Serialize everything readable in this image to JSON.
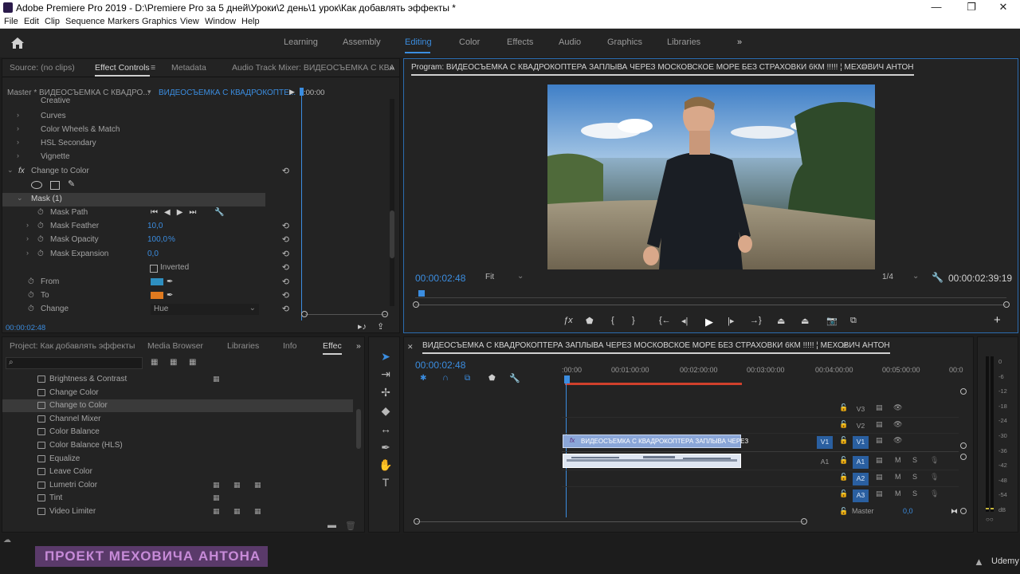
{
  "window": {
    "title": "Adobe Premiere Pro 2019 - D:\\Premiere Pro  за 5 дней\\Уроки\\2 день\\1 урок\\Как добавлять эффекты *",
    "minimize": "—",
    "maximize": "❐",
    "close": "✕"
  },
  "menu": [
    "File",
    "Edit",
    "Clip",
    "Sequence",
    "Markers",
    "Graphics",
    "View",
    "Window",
    "Help"
  ],
  "workspaces": [
    "Learning",
    "Assembly",
    "Editing",
    "Color",
    "Effects",
    "Audio",
    "Graphics",
    "Libraries"
  ],
  "workspace_more": "»",
  "effect_controls": {
    "tabs": [
      "Source: (no clips)",
      "Effect Controls",
      "Metadata",
      "Audio Track Mixer: ВИДЕОСЪЕМКА С КВА"
    ],
    "menu_icon": "≡",
    "more": "»",
    "master_label": "Master * ВИДЕОСЪЕМКА С КВАДРО...",
    "clip_label": "ВИДЕОСЪЕМКА С КВАДРОКОПТЕ...",
    "play_glyph": "▶",
    "timecode_start": ":00:00",
    "lumetri_items": [
      "Creative",
      "Curves",
      "Color Wheels & Match",
      "HSL Secondary",
      "Vignette"
    ],
    "effect_name": "Change to Color",
    "fx_label": "fx",
    "mask_name": "Mask (1)",
    "mask_path_label": "Mask Path",
    "mask_feather_label": "Mask Feather",
    "mask_feather_value": "10,0",
    "mask_opacity_label": "Mask Opacity",
    "mask_opacity_value": "100,0",
    "mask_opacity_unit": "%",
    "mask_expansion_label": "Mask Expansion",
    "mask_expansion_value": "0,0",
    "inverted_label": "Inverted",
    "from_label": "From",
    "from_color": "#2e8fc0",
    "to_label": "To",
    "to_color": "#e07a1f",
    "change_label": "Change",
    "change_value": "Hue",
    "timecode": "00:00:02:48"
  },
  "program": {
    "title": "Program: ВИДЕОСЪЕМКА С КВАДРОКОПТЕРА ЗАПЛЫВА ЧЕРЕЗ МОСКОВСКОЕ МОРЕ БЕЗ СТРАХОВКИ 6КМ !!!!! ¦ МЕХОВИЧ АНТОН",
    "menu_icon": "≡",
    "timecode": "00:00:02:48",
    "fit": "Fit",
    "resolution": "1/4",
    "duration": "00:00:02:39:19",
    "add": "+"
  },
  "project": {
    "tabs": [
      "Project: Как добавлять эффекты",
      "Media Browser",
      "Libraries",
      "Info",
      "Effec"
    ],
    "more": "»",
    "effects": [
      {
        "name": "Brightness & Contrast",
        "badges": 1
      },
      {
        "name": "Change Color",
        "badges": 0
      },
      {
        "name": "Change to Color",
        "badges": 0,
        "selected": true
      },
      {
        "name": "Channel Mixer",
        "badges": 0
      },
      {
        "name": "Color Balance",
        "badges": 0
      },
      {
        "name": "Color Balance (HLS)",
        "badges": 0
      },
      {
        "name": "Equalize",
        "badges": 0
      },
      {
        "name": "Leave Color",
        "badges": 0
      },
      {
        "name": "Lumetri Color",
        "badges": 3
      },
      {
        "name": "Tint",
        "badges": 1
      },
      {
        "name": "Video Limiter",
        "badges": 3
      }
    ]
  },
  "timeline": {
    "title": "ВИДЕОСЪЕМКА С КВАДРОКОПТЕРА ЗАПЛЫВА ЧЕРЕЗ МОСКОВСКОЕ МОРЕ БЕЗ СТРАХОВКИ 6КМ !!!!! ¦ МЕХОВИЧ АНТОН",
    "menu_icon": "≡",
    "timecode": "00:00:02:48",
    "ruler": [
      ":00:00",
      "00:01:00:00",
      "00:02:00:00",
      "00:03:00:00",
      "00:04:00:00",
      "00:05:00:00",
      "00:0"
    ],
    "video_tracks": [
      "V3",
      "V2",
      "V1"
    ],
    "audio_tracks": [
      "A1",
      "A2",
      "A3"
    ],
    "source_v": "V1",
    "source_a": "A1",
    "master_label": "Master",
    "master_value": "0,0",
    "clip_label": "ВИДЕОСЪЕМКА С КВАДРОКОПТЕРА ЗАПЛЫВА ЧЕРЕЗ",
    "clip_fx": "fx",
    "mute": "M",
    "solo": "S"
  },
  "meter": [
    "0",
    "-6",
    "-12",
    "-18",
    "-24",
    "-30",
    "-36",
    "-42",
    "-48",
    "-54",
    "dB"
  ],
  "footer": {
    "watermark": "ПРОЕКТ МЕХОВИЧА АНТОНА",
    "brand": "Udemy",
    "meter_toggle": "○○"
  },
  "colors": {
    "accent": "#3b8de0",
    "panel": "#232323",
    "clip_video": "#8aa6d8",
    "watermark_bg": "#5a3a6a",
    "watermark_text": "#c78bd8"
  }
}
